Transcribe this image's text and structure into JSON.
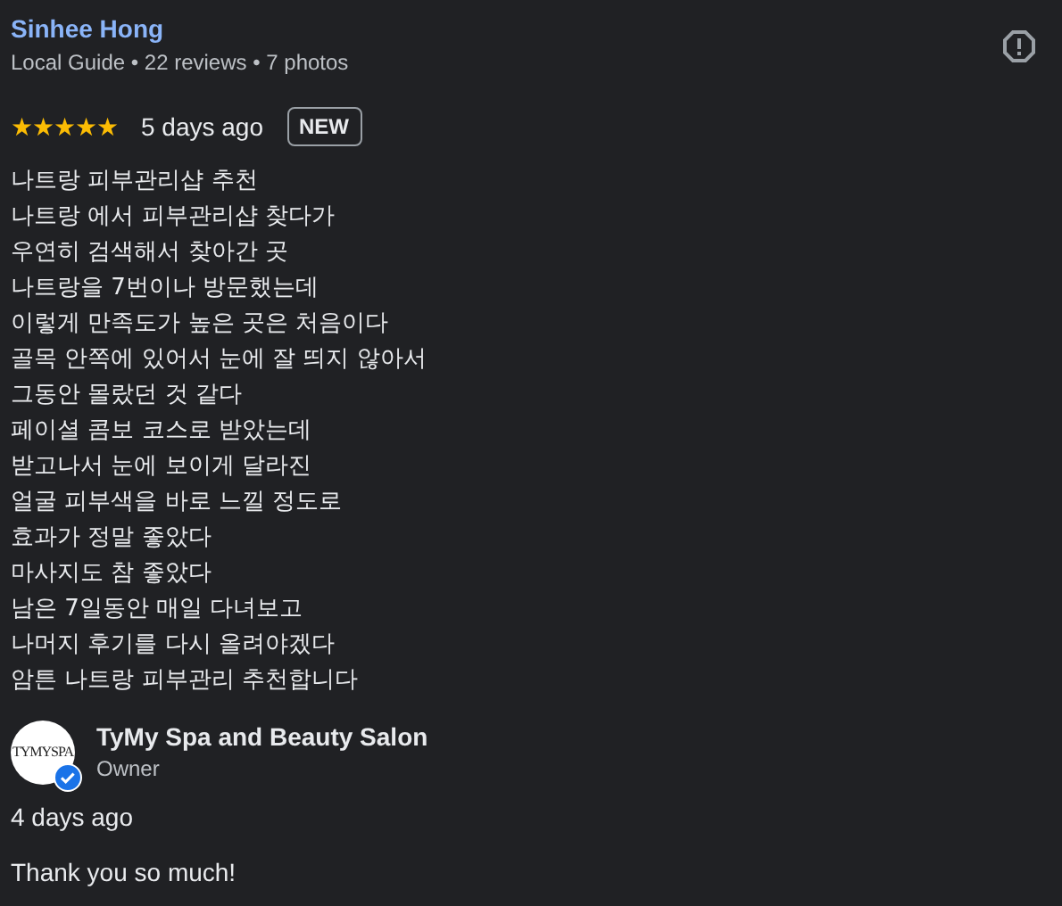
{
  "review": {
    "author": "Sinhee Hong",
    "meta": "Local Guide • 22 reviews • 7 photos",
    "stars": 5,
    "time": "5 days ago",
    "badge": "NEW",
    "lines": [
      "나트랑 피부관리샵 추천",
      "나트랑 에서 피부관리샵 찾다가",
      "우연히 검색해서 찾아간 곳",
      "나트랑을 7번이나 방문했는데",
      "이렇게 만족도가 높은 곳은 처음이다",
      "골목 안쪽에 있어서 눈에 잘 띄지 않아서",
      "그동안 몰랐던 것 같다",
      "페이셜 콤보 코스로 받았는데",
      "받고나서 눈에 보이게 달라진",
      "얼굴 피부색을 바로 느낄 정도로",
      "효과가 정말 좋았다",
      "마사지도 참 좋았다",
      "남은 7일동안 매일 다녀보고",
      "나머지 후기를 다시 올려야겠다",
      "암튼 나트랑 피부관리 추천합니다"
    ]
  },
  "response": {
    "logo_text": "TYMYSPA",
    "owner": "TyMy Spa and Beauty Salon",
    "role": "Owner",
    "verified": true,
    "time": "4 days ago",
    "text": "Thank you so much!"
  }
}
